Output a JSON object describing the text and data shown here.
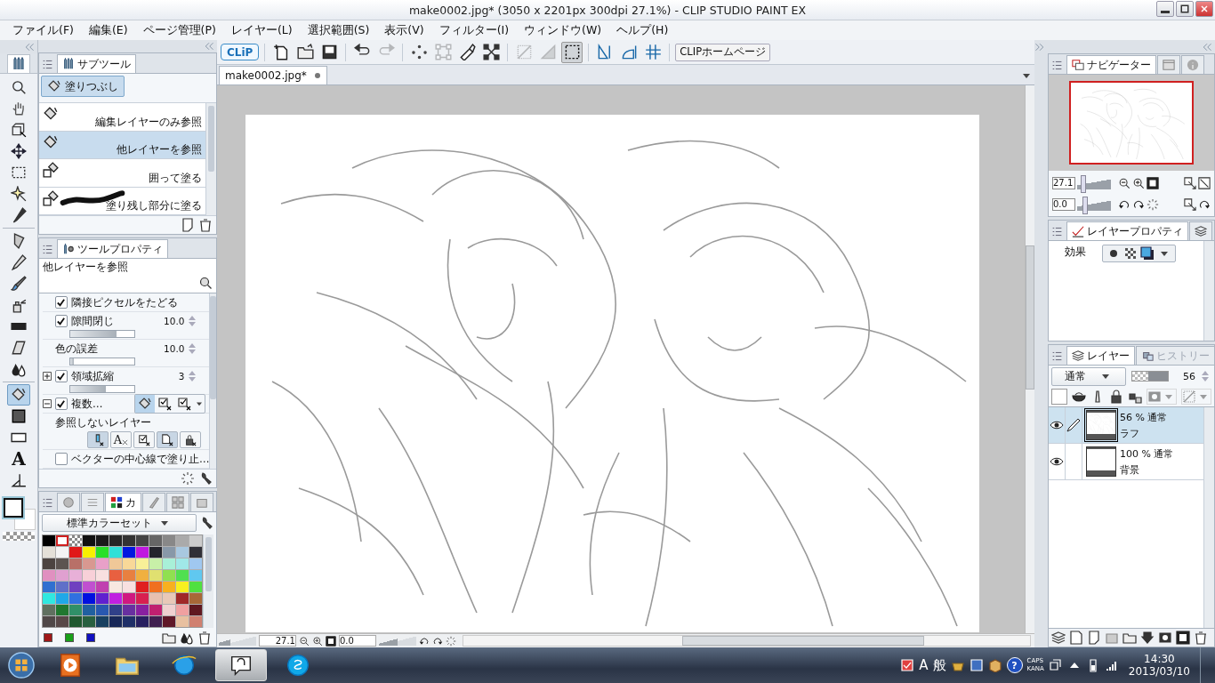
{
  "window": {
    "title": "make0002.jpg* (3050 x 2201px 300dpi 27.1%) - CLIP STUDIO PAINT EX"
  },
  "menu": [
    "ファイル(F)",
    "編集(E)",
    "ページ管理(P)",
    "レイヤー(L)",
    "選択範囲(S)",
    "表示(V)",
    "フィルター(I)",
    "ウィンドウ(W)",
    "ヘルプ(H)"
  ],
  "toolbox": {
    "tools": [
      {
        "kind": "zoom",
        "selected": false
      },
      {
        "kind": "hand",
        "selected": false
      },
      {
        "kind": "object",
        "selected": false
      },
      {
        "kind": "move",
        "selected": false
      },
      {
        "kind": "select",
        "selected": false
      },
      {
        "kind": "wand",
        "selected": false
      },
      {
        "kind": "eyedropper",
        "selected": false
      },
      {
        "kind": "pen",
        "selected": false
      },
      {
        "kind": "pencil",
        "selected": false
      },
      {
        "kind": "brush",
        "selected": false
      },
      {
        "kind": "airbrush",
        "selected": false
      },
      {
        "kind": "band",
        "selected": false
      },
      {
        "kind": "eraser",
        "selected": false
      },
      {
        "kind": "blend",
        "selected": false
      },
      {
        "kind": "fill",
        "selected": true
      },
      {
        "kind": "gradient",
        "selected": false
      },
      {
        "kind": "figure",
        "selected": false
      },
      {
        "kind": "text",
        "glyph": "A",
        "selected": false
      },
      {
        "kind": "ruler",
        "selected": false
      }
    ]
  },
  "subtool": {
    "tab": "サブツール",
    "group": {
      "label": "塗りつぶし",
      "selected": true
    },
    "items": [
      {
        "kind": "reference",
        "label": "編集レイヤーのみ参照",
        "selected": false
      },
      {
        "kind": "reference",
        "label": "他レイヤーを参照",
        "selected": true
      },
      {
        "kind": "enclose",
        "label": "囲って塗る",
        "selected": false
      },
      {
        "kind": "stroke",
        "label": "塗り残し部分に塗る",
        "selected": false
      }
    ]
  },
  "tool_property": {
    "tab": "ツールプロパティ",
    "title": "他レイヤーを参照",
    "rows": [
      {
        "kind": "check",
        "label": "隣接ピクセルをたどる",
        "checked": true
      },
      {
        "kind": "slider",
        "label": "隙間閉じ",
        "checked": true,
        "level": 0.72,
        "value": "10.0"
      },
      {
        "kind": "slider",
        "label": "色の誤差",
        "level": 0.05,
        "value": "10.0"
      },
      {
        "kind": "slider",
        "label": "領域拡縮",
        "checked": true,
        "expanded": false,
        "level": 0.55,
        "value": "3"
      },
      {
        "kind": "buttons",
        "label": "複数…",
        "checked": true,
        "expanded": true,
        "buttons": [
          {
            "selected": true
          },
          {
            "selected": false
          },
          {
            "selected": false
          }
        ]
      },
      {
        "kind": "exclude",
        "label": "参照しないレイヤー",
        "buttons": [
          {
            "kind": "draft",
            "selected": true
          },
          {
            "kind": "text",
            "glyph": "A",
            "selected": false
          },
          {
            "kind": "paper",
            "selected": false
          },
          {
            "kind": "blank",
            "selected": true
          },
          {
            "kind": "locked",
            "selected": false
          }
        ]
      },
      {
        "kind": "check",
        "label": "ベクターの中心線で塗り止…",
        "checked": false
      }
    ]
  },
  "color_set": {
    "tab": "カ",
    "preset": "標準カラーセット",
    "swatches": [
      {
        "color": "#000000",
        "selected": false
      },
      {
        "color": "#ffffff",
        "selected": true
      },
      {
        "kind": "transparent",
        "selected": false
      },
      {
        "color": "#111111",
        "selected": false
      },
      {
        "color": "#1a1a1a",
        "selected": false
      },
      {
        "color": "#262626",
        "selected": false
      },
      {
        "color": "#333333",
        "selected": false
      },
      {
        "color": "#444444",
        "selected": false
      },
      {
        "color": "#666666",
        "selected": false
      },
      {
        "color": "#888888",
        "selected": false
      },
      {
        "color": "#aaaaaa",
        "selected": false
      },
      {
        "color": "#cccccc",
        "selected": false
      },
      {
        "color": "#e4e0d8",
        "selected": false
      },
      {
        "color": "#f4f4f4",
        "selected": false
      },
      {
        "color": "#e01818",
        "selected": false
      },
      {
        "color": "#f8f000",
        "selected": false
      },
      {
        "color": "#28e028",
        "selected": false
      },
      {
        "color": "#30e0d8",
        "selected": false
      },
      {
        "color": "#0018e0",
        "selected": false
      },
      {
        "color": "#c018e0",
        "selected": false
      },
      {
        "color": "#24242c",
        "selected": false
      },
      {
        "color": "#8898a8",
        "selected": false
      },
      {
        "color": "#a8c8e0",
        "selected": false
      },
      {
        "color": "#303038",
        "selected": false
      },
      {
        "color": "#4c4440",
        "selected": false
      },
      {
        "color": "#5c5450",
        "selected": false
      },
      {
        "color": "#b87068",
        "selected": false
      },
      {
        "color": "#d89890",
        "selected": false
      },
      {
        "color": "#e8a0c8",
        "selected": false
      },
      {
        "color": "#f0c898",
        "selected": false
      },
      {
        "color": "#f8d898",
        "selected": false
      },
      {
        "color": "#f8f098",
        "selected": false
      },
      {
        "color": "#c8f0a8",
        "selected": false
      },
      {
        "color": "#a8f0d8",
        "selected": false
      },
      {
        "color": "#a0e8e8",
        "selected": false
      },
      {
        "color": "#a0c8f0",
        "selected": false
      },
      {
        "color": "#e090c0",
        "selected": false
      },
      {
        "color": "#e0a0d0",
        "selected": false
      },
      {
        "color": "#e8b0d8",
        "selected": false
      },
      {
        "color": "#f8d0d8",
        "selected": false
      },
      {
        "color": "#f8e0e0",
        "selected": false
      },
      {
        "color": "#e86040",
        "selected": false
      },
      {
        "color": "#e88040",
        "selected": false
      },
      {
        "color": "#f0b040",
        "selected": false
      },
      {
        "color": "#e0e070",
        "selected": false
      },
      {
        "color": "#90e050",
        "selected": false
      },
      {
        "color": "#50e050",
        "selected": false
      },
      {
        "color": "#60c8f0",
        "selected": false
      },
      {
        "color": "#3070d0",
        "selected": false
      },
      {
        "color": "#6070c8",
        "selected": false
      },
      {
        "color": "#7040c0",
        "selected": false
      },
      {
        "color": "#c050d0",
        "selected": false
      },
      {
        "color": "#c040b0",
        "selected": false
      },
      {
        "color": "#f8e8e0",
        "selected": false
      },
      {
        "color": "#f8e0e0",
        "selected": false
      },
      {
        "color": "#e02020",
        "selected": false
      },
      {
        "color": "#f07020",
        "selected": false
      },
      {
        "color": "#f8b020",
        "selected": false
      },
      {
        "color": "#f8f020",
        "selected": false
      },
      {
        "color": "#50e040",
        "selected": false
      },
      {
        "color": "#30e8e0",
        "selected": false
      },
      {
        "color": "#20a8e8",
        "selected": false
      },
      {
        "color": "#3070e0",
        "selected": false
      },
      {
        "color": "#0010e0",
        "selected": false
      },
      {
        "color": "#6020d0",
        "selected": false
      },
      {
        "color": "#c020e0",
        "selected": false
      },
      {
        "color": "#d01880",
        "selected": false
      },
      {
        "color": "#d82050",
        "selected": false
      },
      {
        "color": "#e8c0b0",
        "selected": false
      },
      {
        "color": "#e8c8b8",
        "selected": false
      },
      {
        "color": "#a02828",
        "selected": false
      },
      {
        "color": "#a86838",
        "selected": false
      },
      {
        "color": "#607060",
        "selected": false
      },
      {
        "color": "#207830",
        "selected": false
      },
      {
        "color": "#309068",
        "selected": false
      },
      {
        "color": "#2060a0",
        "selected": false
      },
      {
        "color": "#2858b0",
        "selected": false
      },
      {
        "color": "#304088",
        "selected": false
      },
      {
        "color": "#6830a0",
        "selected": false
      },
      {
        "color": "#8820a0",
        "selected": false
      },
      {
        "color": "#c02070",
        "selected": false
      },
      {
        "color": "#f0d0d0",
        "selected": false
      },
      {
        "color": "#f0a0a0",
        "selected": false
      },
      {
        "color": "#601820",
        "selected": false
      },
      {
        "color": "#504848",
        "selected": false
      },
      {
        "color": "#584848",
        "selected": false
      },
      {
        "color": "#205830",
        "selected": false
      },
      {
        "color": "#286040",
        "selected": false
      },
      {
        "color": "#184060",
        "selected": false
      },
      {
        "color": "#182858",
        "selected": false
      },
      {
        "color": "#203068",
        "selected": false
      },
      {
        "color": "#282060",
        "selected": false
      },
      {
        "color": "#402050",
        "selected": false
      },
      {
        "color": "#601828",
        "selected": false
      },
      {
        "color": "#e8c0a0",
        "selected": false
      },
      {
        "color": "#d08070",
        "selected": false
      }
    ],
    "recent": [
      {
        "color": "#a01818"
      },
      {
        "color": "#18a018"
      },
      {
        "color": "#1010c0"
      }
    ]
  },
  "toolbar": {
    "logo": "CLiP",
    "home": "CLIPホームページ",
    "buttons": [
      {
        "kind": "new",
        "disabled": false,
        "selected": false
      },
      {
        "kind": "open",
        "disabled": false,
        "selected": false
      },
      {
        "kind": "save",
        "disabled": false,
        "selected": false
      },
      {
        "kind": "separator"
      },
      {
        "kind": "undo",
        "disabled": false,
        "selected": false
      },
      {
        "kind": "redo",
        "disabled": true,
        "selected": false
      },
      {
        "kind": "separator"
      },
      {
        "kind": "dots",
        "disabled": false,
        "selected": false
      },
      {
        "kind": "transform",
        "disabled": true,
        "selected": false
      },
      {
        "kind": "fillsel",
        "disabled": false,
        "selected": false
      },
      {
        "kind": "crossarrows",
        "disabled": false,
        "selected": false
      },
      {
        "kind": "separator"
      },
      {
        "kind": "slash",
        "disabled": true,
        "selected": false
      },
      {
        "kind": "halfsquare",
        "disabled": true,
        "selected": false
      },
      {
        "kind": "dashsquare",
        "disabled": false,
        "selected": true
      },
      {
        "kind": "separator"
      },
      {
        "kind": "ruler1",
        "disabled": false,
        "selected": false
      },
      {
        "kind": "ruler2",
        "disabled": false,
        "selected": false
      },
      {
        "kind": "grid",
        "disabled": false,
        "selected": false
      }
    ]
  },
  "document": {
    "tab": "make0002.jpg*",
    "selected": true
  },
  "canvas_status": {
    "zoom": "27.1",
    "zoom_slider": {
      "level": 0.3
    },
    "angle": "0.0",
    "angle_slider": {
      "level": 0.5
    }
  },
  "navigator": {
    "tab": "ナビゲーター",
    "zoom": "27.1",
    "zoom_slider": {
      "level": 0.1
    },
    "rotation": "0.0",
    "rotation_slider": {
      "level": 0.15
    }
  },
  "layer_property": {
    "tab": "レイヤープロパティ",
    "effect_label": "効果"
  },
  "layers": {
    "tabs": [
      {
        "label": "レイヤー",
        "selected": true
      },
      {
        "label": "ヒストリー",
        "selected": false
      }
    ],
    "blend_mode": "通常",
    "opacity": "56",
    "opacity_slider": {
      "level": 0.56
    },
    "items": [
      {
        "kind": "sketch",
        "info": "56 % 通常",
        "name": "ラフ",
        "visible": true,
        "editing": true,
        "selected": true
      },
      {
        "kind": "paper",
        "info": "100 % 通常",
        "name": "背景",
        "visible": true,
        "editing": false,
        "selected": false
      }
    ]
  },
  "taskbar": {
    "apps": [
      {
        "kind": "media",
        "selected": false
      },
      {
        "kind": "folder",
        "selected": false
      },
      {
        "kind": "browser",
        "selected": false
      },
      {
        "kind": "clip",
        "selected": true
      },
      {
        "kind": "skype",
        "selected": false
      }
    ],
    "tray": {
      "ime": "A",
      "ime_mode": "般",
      "help": "?",
      "caps": "CAPS",
      "kana": "KANA",
      "time": "14:30",
      "date": "2013/03/10"
    }
  }
}
